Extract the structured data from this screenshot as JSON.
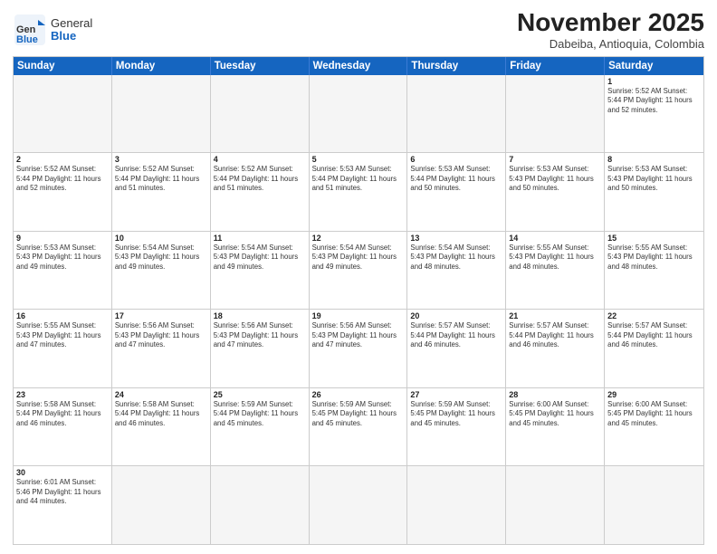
{
  "logo": {
    "general": "General",
    "blue": "Blue"
  },
  "header": {
    "month": "November 2025",
    "location": "Dabeiba, Antioquia, Colombia"
  },
  "weekdays": [
    "Sunday",
    "Monday",
    "Tuesday",
    "Wednesday",
    "Thursday",
    "Friday",
    "Saturday"
  ],
  "rows": [
    [
      {
        "day": "",
        "text": ""
      },
      {
        "day": "",
        "text": ""
      },
      {
        "day": "",
        "text": ""
      },
      {
        "day": "",
        "text": ""
      },
      {
        "day": "",
        "text": ""
      },
      {
        "day": "",
        "text": ""
      },
      {
        "day": "1",
        "text": "Sunrise: 5:52 AM\nSunset: 5:44 PM\nDaylight: 11 hours\nand 52 minutes."
      }
    ],
    [
      {
        "day": "2",
        "text": "Sunrise: 5:52 AM\nSunset: 5:44 PM\nDaylight: 11 hours\nand 52 minutes."
      },
      {
        "day": "3",
        "text": "Sunrise: 5:52 AM\nSunset: 5:44 PM\nDaylight: 11 hours\nand 51 minutes."
      },
      {
        "day": "4",
        "text": "Sunrise: 5:52 AM\nSunset: 5:44 PM\nDaylight: 11 hours\nand 51 minutes."
      },
      {
        "day": "5",
        "text": "Sunrise: 5:53 AM\nSunset: 5:44 PM\nDaylight: 11 hours\nand 51 minutes."
      },
      {
        "day": "6",
        "text": "Sunrise: 5:53 AM\nSunset: 5:44 PM\nDaylight: 11 hours\nand 50 minutes."
      },
      {
        "day": "7",
        "text": "Sunrise: 5:53 AM\nSunset: 5:43 PM\nDaylight: 11 hours\nand 50 minutes."
      },
      {
        "day": "8",
        "text": "Sunrise: 5:53 AM\nSunset: 5:43 PM\nDaylight: 11 hours\nand 50 minutes."
      }
    ],
    [
      {
        "day": "9",
        "text": "Sunrise: 5:53 AM\nSunset: 5:43 PM\nDaylight: 11 hours\nand 49 minutes."
      },
      {
        "day": "10",
        "text": "Sunrise: 5:54 AM\nSunset: 5:43 PM\nDaylight: 11 hours\nand 49 minutes."
      },
      {
        "day": "11",
        "text": "Sunrise: 5:54 AM\nSunset: 5:43 PM\nDaylight: 11 hours\nand 49 minutes."
      },
      {
        "day": "12",
        "text": "Sunrise: 5:54 AM\nSunset: 5:43 PM\nDaylight: 11 hours\nand 49 minutes."
      },
      {
        "day": "13",
        "text": "Sunrise: 5:54 AM\nSunset: 5:43 PM\nDaylight: 11 hours\nand 48 minutes."
      },
      {
        "day": "14",
        "text": "Sunrise: 5:55 AM\nSunset: 5:43 PM\nDaylight: 11 hours\nand 48 minutes."
      },
      {
        "day": "15",
        "text": "Sunrise: 5:55 AM\nSunset: 5:43 PM\nDaylight: 11 hours\nand 48 minutes."
      }
    ],
    [
      {
        "day": "16",
        "text": "Sunrise: 5:55 AM\nSunset: 5:43 PM\nDaylight: 11 hours\nand 47 minutes."
      },
      {
        "day": "17",
        "text": "Sunrise: 5:56 AM\nSunset: 5:43 PM\nDaylight: 11 hours\nand 47 minutes."
      },
      {
        "day": "18",
        "text": "Sunrise: 5:56 AM\nSunset: 5:43 PM\nDaylight: 11 hours\nand 47 minutes."
      },
      {
        "day": "19",
        "text": "Sunrise: 5:56 AM\nSunset: 5:43 PM\nDaylight: 11 hours\nand 47 minutes."
      },
      {
        "day": "20",
        "text": "Sunrise: 5:57 AM\nSunset: 5:44 PM\nDaylight: 11 hours\nand 46 minutes."
      },
      {
        "day": "21",
        "text": "Sunrise: 5:57 AM\nSunset: 5:44 PM\nDaylight: 11 hours\nand 46 minutes."
      },
      {
        "day": "22",
        "text": "Sunrise: 5:57 AM\nSunset: 5:44 PM\nDaylight: 11 hours\nand 46 minutes."
      }
    ],
    [
      {
        "day": "23",
        "text": "Sunrise: 5:58 AM\nSunset: 5:44 PM\nDaylight: 11 hours\nand 46 minutes."
      },
      {
        "day": "24",
        "text": "Sunrise: 5:58 AM\nSunset: 5:44 PM\nDaylight: 11 hours\nand 46 minutes."
      },
      {
        "day": "25",
        "text": "Sunrise: 5:59 AM\nSunset: 5:44 PM\nDaylight: 11 hours\nand 45 minutes."
      },
      {
        "day": "26",
        "text": "Sunrise: 5:59 AM\nSunset: 5:45 PM\nDaylight: 11 hours\nand 45 minutes."
      },
      {
        "day": "27",
        "text": "Sunrise: 5:59 AM\nSunset: 5:45 PM\nDaylight: 11 hours\nand 45 minutes."
      },
      {
        "day": "28",
        "text": "Sunrise: 6:00 AM\nSunset: 5:45 PM\nDaylight: 11 hours\nand 45 minutes."
      },
      {
        "day": "29",
        "text": "Sunrise: 6:00 AM\nSunset: 5:45 PM\nDaylight: 11 hours\nand 45 minutes."
      }
    ],
    [
      {
        "day": "30",
        "text": "Sunrise: 6:01 AM\nSunset: 5:46 PM\nDaylight: 11 hours\nand 44 minutes."
      },
      {
        "day": "",
        "text": ""
      },
      {
        "day": "",
        "text": ""
      },
      {
        "day": "",
        "text": ""
      },
      {
        "day": "",
        "text": ""
      },
      {
        "day": "",
        "text": ""
      },
      {
        "day": "",
        "text": ""
      }
    ]
  ]
}
